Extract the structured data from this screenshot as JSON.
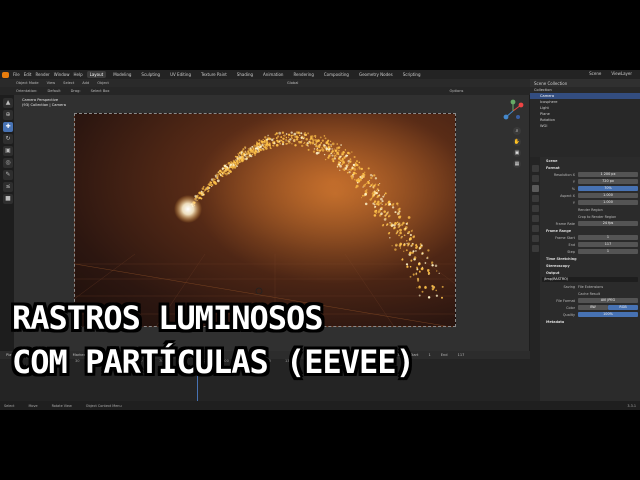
{
  "topbar": {
    "menus": [
      "File",
      "Edit",
      "Render",
      "Window",
      "Help"
    ],
    "workspaces": [
      "Layout",
      "Modeling",
      "Sculpting",
      "UV Editing",
      "Texture Paint",
      "Shading",
      "Animation",
      "Rendering",
      "Compositing",
      "Geometry Nodes",
      "Scripting"
    ],
    "active_workspace": "Layout",
    "scene": "Scene",
    "view_layer": "ViewLayer"
  },
  "viewport_header": {
    "mode": "Object Mode",
    "menus": [
      "View",
      "Select",
      "Add",
      "Object"
    ],
    "orientation_label": "Orientation:",
    "orientation": "Default",
    "drag_label": "Drag:",
    "drag": "Select Box",
    "transform": "Global",
    "options": "Options"
  },
  "viewport": {
    "camera_title": "Camera Perspective",
    "camera_subtitle": "(93) Collection | Camera"
  },
  "outliner": {
    "title": "Scene Collection",
    "items": [
      {
        "label": "Collection",
        "selected": false
      },
      {
        "label": "Camera",
        "selected": true
      },
      {
        "label": "Icosphere",
        "selected": false
      },
      {
        "label": "Light",
        "selected": false
      },
      {
        "label": "Plane",
        "selected": false
      },
      {
        "label": "Rotation",
        "selected": false
      },
      {
        "label": "WGI",
        "selected": false
      }
    ]
  },
  "properties": {
    "scene_label": "Scene",
    "format_section": "Format",
    "resolution_x": "1 200 px",
    "resolution_y": "720 px",
    "percent": "70%",
    "aspect_x": "1.000",
    "aspect_y": "1.000",
    "render_region": "Render Region",
    "crop": "Crop to Render Region",
    "frame_rate_label": "Frame Rate",
    "frame_rate": "24 fps",
    "frame_range": "Frame Range",
    "frame_start_label": "Frame Start",
    "frame_start": "1",
    "end_label": "End",
    "end": "117",
    "step_label": "Step",
    "step": "1",
    "time_stretching": "Time Stretching",
    "stereoscopy": "Stereoscopy",
    "output_section": "Output",
    "output_path": "/tmp/RASTRO/",
    "saving_label": "Saving",
    "file_extensions": "File Extensions",
    "cache_result": "Cache Result",
    "file_format_label": "File Format",
    "file_format": "AVI JPEG",
    "color_label": "Color",
    "color_bw": "BW",
    "color_rgb": "RGB",
    "quality_label": "Quality",
    "quality": "100%",
    "metadata": "Metadata"
  },
  "timeline": {
    "menus": [
      "Playback",
      "Keying",
      "View",
      "Marker"
    ],
    "start_label": "Start",
    "start": "1",
    "end_label": "End",
    "end": "117",
    "current_frame": "93",
    "ticks": [
      "0",
      "10",
      "20",
      "30",
      "40",
      "50",
      "60",
      "70",
      "80",
      "90",
      "100",
      "110",
      "120",
      "130",
      "140",
      "150"
    ]
  },
  "statusbar": {
    "items": [
      "Select",
      "Move",
      "Rotate View",
      "Object Context Menu"
    ],
    "version": "3.3.1"
  },
  "overlay_title": {
    "line1": "RASTROS LUMINOSOS",
    "line2": "COM PARTÍCULAS (EEVEE)"
  },
  "colors": {
    "accent": "#4772b3",
    "blender_orange": "#e87d0d",
    "particle": "#ffc24a",
    "render_bg": "#5c2d17"
  }
}
